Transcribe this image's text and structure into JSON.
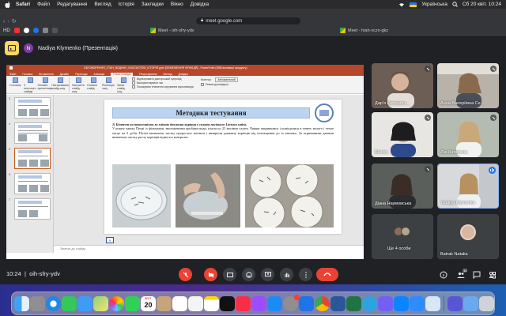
{
  "menubar": {
    "app": "Safari",
    "items": [
      "Файл",
      "Редагування",
      "Вигляд",
      "Історія",
      "Закладки",
      "Вікно",
      "Довідка"
    ],
    "input_source": "Українська",
    "clock": "Сб 20 квіт.  10:24"
  },
  "browser": {
    "address": "meet.google.com",
    "bookmark_hd": "HD",
    "tab1": "Meet - oih-sfry-ydv",
    "tab2": "Meet - hiah-vczn-gkz"
  },
  "presentation_banner": {
    "avatar_initial": "N",
    "presenter": "Nadiya Klymenko (Презентація)"
  },
  "powerpoint": {
    "title": "ОБГОВОРЕННЯ_СТАН_ВОДНИХ_ЕКОСИСТЕМ_ІСТОРІЯ.pptx [ОБМЕЖЕННЯ ФУНКЦІЙ] - PowerPoint (Збій активації продукту)",
    "tabs": [
      "Файл",
      "Головна",
      "Вставлення",
      "Дизайн",
      "Переходи",
      "Анімація",
      "Показ слайдів",
      "Рецензування",
      "Вигляд",
      "Довідка"
    ],
    "active_tab": "Показ слайдів",
    "ribbon_buttons": [
      "З початку",
      "З поточного слайда",
      "Онлайн-презентація",
      "Настроювана слайд-шоу",
      "Настроїти слайд-шоу",
      "Сховати слайд",
      "Репетиція часу",
      "Запис слайд-шоу"
    ],
    "ribbon_checks": [
      "Відтворювати дикторський супровід",
      "Використовувати час",
      "Показувати елементи керування мультимедіа"
    ],
    "monitor_label": "Монітор:",
    "monitor_value": "Автоматичний",
    "presenter_view": "Режим доповідача",
    "slide_title": "Методики тестування",
    "slide_heading": "1) Біотест на токсичність за зміною довжини корінця у салату посівного Lactuca sativa.",
    "slide_body": "У кожну чашку Петрі із фільтрами, зволоженими пробами води, клали по 25 насінин салату. Чашки закривалися і поміщалися в темне, вологе і тепле місце на 3 доби. Потім визначали частку пророслих насінин і вимірили довжину корінців від потовщення до їх кінчика. За отриманими даними визначали частку росту корінців відносно контролю.",
    "slide_number": "5",
    "notes_placeholder": "Замітки до слайду",
    "thumb_numbers": [
      "3",
      "4",
      "5",
      "6",
      "7"
    ]
  },
  "participants": [
    {
      "name": "Дарʼя Катеринч...",
      "mic": "off"
    },
    {
      "name": "Анна Валеріївна Се...",
      "mic": "off"
    },
    {
      "name": "Klecko",
      "mic": "off"
    },
    {
      "name": "Лізі Катерина",
      "mic": "off"
    },
    {
      "name": "Діана Наумовська",
      "mic": "off"
    },
    {
      "name": "Nadiya Klymenko",
      "mic": "on"
    },
    {
      "name": "Ще 4 особи",
      "mic": ""
    },
    {
      "name": "Batrak Natalia",
      "mic": ""
    }
  ],
  "meeting": {
    "time": "10:24",
    "code": "oih-sfry-ydv",
    "participant_count": "12"
  },
  "dock": {
    "calendar_month": "КВІТ.",
    "calendar_day": "20"
  },
  "colors": {
    "ppt_accent": "#b7472a",
    "meet_bg": "#202124",
    "end_call": "#ea4335",
    "present_yellow": "#fdd663"
  }
}
